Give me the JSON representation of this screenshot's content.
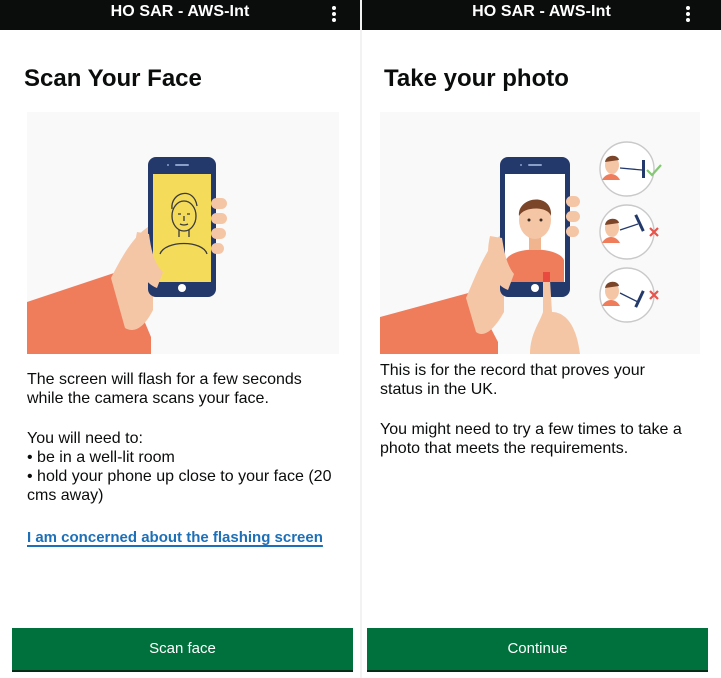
{
  "left_screen": {
    "app_title": "HO SAR - AWS-Int",
    "heading": "Scan Your Face",
    "paragraph_1_line_1": "The screen will flash for a few seconds",
    "paragraph_1_line_2": "while the camera scans your face.",
    "needs_intro": "You will need to:",
    "needs": [
      "• be in a well-lit room",
      "• hold your phone up close to your face (20",
      "cms away)"
    ],
    "link_text": "I am concerned about the flashing screen",
    "button_label": "Scan face"
  },
  "right_screen": {
    "app_title": "HO SAR - AWS-Int",
    "heading": "Take your photo",
    "paragraph_1_line_1": "This is for the record that proves your",
    "paragraph_1_line_2": "status in the UK.",
    "paragraph_2_line_1": "You might need to try a few times to take a",
    "paragraph_2_line_2": "photo that meets the requirements.",
    "button_label": "Continue"
  },
  "icons": {
    "menu": "more-vert-icon",
    "tick": "check-icon",
    "cross": "cross-icon"
  },
  "colors": {
    "app_bar": "#0b0c0c",
    "button_green": "#00703c",
    "link_blue": "#1d70b8",
    "tick_green": "#84c873",
    "cross_red": "#e8534a"
  }
}
